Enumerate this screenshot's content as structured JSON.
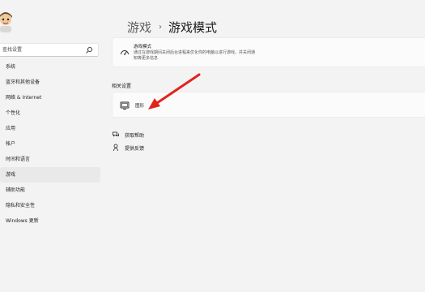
{
  "sidebar": {
    "search_placeholder": "查找设置",
    "items": [
      {
        "label": "系统"
      },
      {
        "label": "蓝牙和其他设备"
      },
      {
        "label": "网络 & Internet"
      },
      {
        "label": "个性化"
      },
      {
        "label": "应用"
      },
      {
        "label": "帐户"
      },
      {
        "label": "时间和语言"
      },
      {
        "label": "游戏",
        "active": true
      },
      {
        "label": "辅助功能"
      },
      {
        "label": "隐私和安全性"
      },
      {
        "label": "Windows 更新"
      }
    ]
  },
  "breadcrumb": {
    "parent": "游戏",
    "separator": "›",
    "current": "游戏模式"
  },
  "game_mode_card": {
    "title": "游戏模式",
    "description": "通过在游戏期间关闭后台进程来优化你的电脑以进行游戏，并关闭通知等更多信息",
    "icon": "game-mode-gauge-icon"
  },
  "related_settings": {
    "title": "相关设置",
    "graphics": {
      "label": "图形",
      "icon": "monitor-icon"
    }
  },
  "links": {
    "help": {
      "label": "获取帮助",
      "icon": "help-icon"
    },
    "feedback": {
      "label": "提供反馈",
      "icon": "feedback-icon"
    }
  },
  "annotation": {
    "color": "#e0241b"
  }
}
